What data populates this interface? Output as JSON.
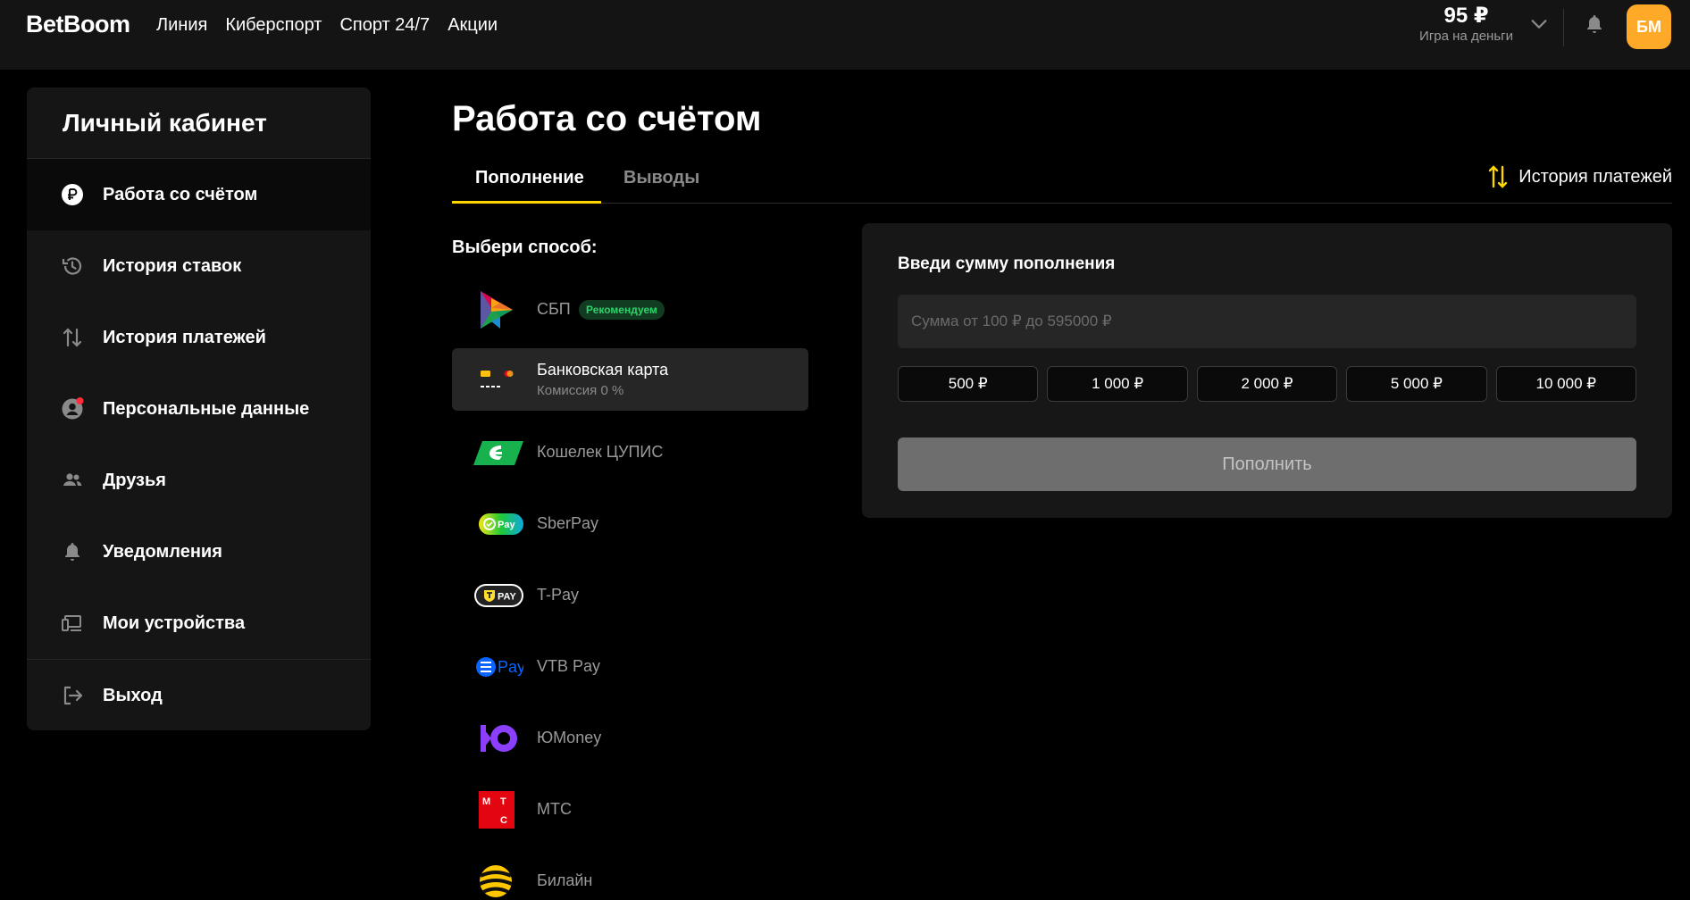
{
  "header": {
    "logo": "BetBoom",
    "nav": [
      "Линия",
      "Киберспорт",
      "Спорт 24/7",
      "Акции"
    ],
    "balance_amount": "95 ₽",
    "balance_label": "Игра на деньги",
    "avatar_initials": "БМ"
  },
  "sidebar": {
    "title": "Личный кабинет",
    "items": [
      {
        "label": "Работа со счётом",
        "icon": "ruble-icon",
        "active": true
      },
      {
        "label": "История ставок",
        "icon": "history-icon"
      },
      {
        "label": "История платежей",
        "icon": "transfer-arrows-icon"
      },
      {
        "label": "Персональные данные",
        "icon": "user-icon",
        "notification": true
      },
      {
        "label": "Друзья",
        "icon": "friends-icon"
      },
      {
        "label": "Уведомления",
        "icon": "bell-icon"
      },
      {
        "label": "Мои устройства",
        "icon": "devices-icon"
      },
      {
        "label": "Выход",
        "icon": "logout-icon"
      }
    ]
  },
  "main": {
    "title": "Работа со счётом",
    "tabs": [
      {
        "label": "Пополнение",
        "active": true
      },
      {
        "label": "Выводы",
        "active": false
      }
    ],
    "history_link": "История платежей",
    "choose_label": "Выбери способ:",
    "methods": [
      {
        "name": "СБП",
        "badge": "Рекомендуем",
        "logo": "sbp-logo"
      },
      {
        "name": "Банковская карта",
        "sub": "Комиссия 0 %",
        "selected": true,
        "logo": "bank-card-logo"
      },
      {
        "name": "Кошелек ЦУПИС",
        "logo": "cupis-logo"
      },
      {
        "name": "SberPay",
        "logo": "sberpay-logo"
      },
      {
        "name": "T-Pay",
        "logo": "tpay-logo"
      },
      {
        "name": "VTB Pay",
        "logo": "vtbpay-logo"
      },
      {
        "name": "ЮMoney",
        "logo": "yumoney-logo"
      },
      {
        "name": "МТС",
        "logo": "mts-logo"
      },
      {
        "name": "Билайн",
        "logo": "beeline-logo"
      }
    ]
  },
  "deposit": {
    "title": "Введи сумму пополнения",
    "placeholder": "Сумма от 100 ₽ до 595000 ₽",
    "quick_amounts": [
      "500 ₽",
      "1 000 ₽",
      "2 000 ₽",
      "5 000 ₽",
      "10 000 ₽"
    ],
    "submit_label": "Пополнить"
  },
  "colors": {
    "accent": "#ffd500",
    "avatar": "#ffa929",
    "badge_text": "#2fd26a",
    "notification_dot": "#ff2d3b"
  }
}
